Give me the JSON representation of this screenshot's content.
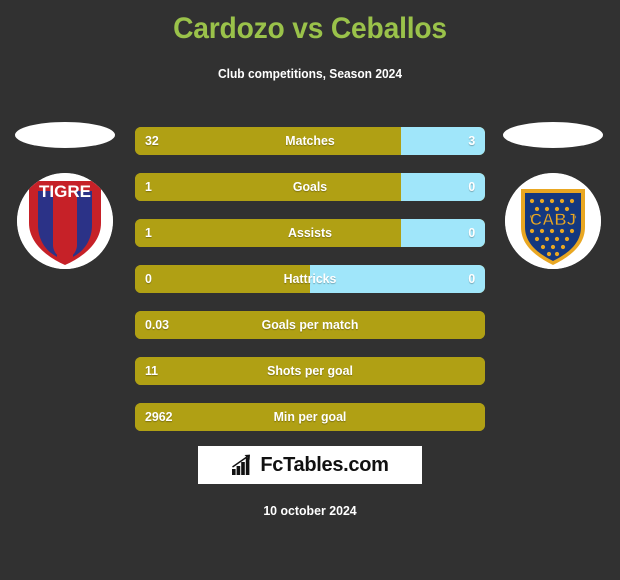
{
  "header": {
    "title": "Cardozo vs Ceballos",
    "subtitle": "Club competitions, Season 2024",
    "title_color": "#9ac24a",
    "subtitle_color": "#ffffff"
  },
  "theme": {
    "background": "#313131",
    "home_color": "#b0a014",
    "away_color": "#a0e6fa",
    "text_color": "#ffffff"
  },
  "teams": {
    "home": {
      "crest_name": "tigre-crest",
      "crest_text": "TIGRE"
    },
    "away": {
      "crest_name": "boca-juniors-crest",
      "crest_text": "CABJ"
    }
  },
  "chart_data": {
    "type": "bar",
    "title": "Cardozo vs Ceballos",
    "subtitle": "Club competitions, Season 2024",
    "orientation": "horizontal-diverging",
    "categories": [
      "Matches",
      "Goals",
      "Assists",
      "Hattricks",
      "Goals per match",
      "Shots per goal",
      "Min per goal"
    ],
    "series": [
      {
        "name": "Cardozo",
        "color": "#b0a014",
        "values": [
          "32",
          "1",
          "1",
          "0",
          "0.03",
          "11",
          "2962"
        ]
      },
      {
        "name": "Ceballos",
        "color": "#a0e6fa",
        "values": [
          "3",
          "0",
          "0",
          "0",
          "",
          "",
          ""
        ]
      }
    ],
    "rows": [
      {
        "label": "Matches",
        "home": "32",
        "away": "3",
        "home_pct": 76,
        "has_away": true
      },
      {
        "label": "Goals",
        "home": "1",
        "away": "0",
        "home_pct": 76,
        "has_away": true
      },
      {
        "label": "Assists",
        "home": "1",
        "away": "0",
        "home_pct": 76,
        "has_away": true
      },
      {
        "label": "Hattricks",
        "home": "0",
        "away": "0",
        "home_pct": 50,
        "has_away": true
      },
      {
        "label": "Goals per match",
        "home": "0.03",
        "away": "",
        "home_pct": 100,
        "has_away": false
      },
      {
        "label": "Shots per goal",
        "home": "11",
        "away": "",
        "home_pct": 100,
        "has_away": false
      },
      {
        "label": "Min per goal",
        "home": "2962",
        "away": "",
        "home_pct": 100,
        "has_away": false
      }
    ]
  },
  "branding": {
    "text": "FcTables.com",
    "icon": "bar-chart-growth-icon"
  },
  "footer": {
    "date": "10 october 2024"
  }
}
